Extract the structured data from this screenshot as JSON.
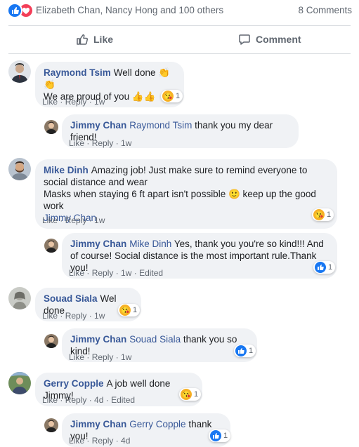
{
  "summary": {
    "reaction_names": "Elizabeth Chan, Nancy Hong and 100 others",
    "comment_count": "8 Comments"
  },
  "actions": {
    "like": "Like",
    "comment": "Comment"
  },
  "meta_words": {
    "like": "Like",
    "reply": "Reply",
    "sep": " · ",
    "edited": "Edited"
  },
  "colors": {
    "link": "#385898",
    "like_blue": "#1877f2",
    "love_red": "#f33e58",
    "bubble": "#f0f2f5"
  },
  "comments": [
    {
      "author": "Raymond Tsim",
      "line1": "Well done 👏👏",
      "line2": "We are proud of you 👍👍",
      "time": "1w",
      "reaction": {
        "icon": "care-emoji-icon",
        "count": "1"
      }
    },
    {
      "author": "Jimmy Chan",
      "mention": "Raymond Tsim",
      "text": "thank you my dear friend!",
      "time": "1w"
    },
    {
      "author": "Mike Dinh",
      "line1": "Amazing job! Just make sure to remind everyone to social distance and wear",
      "line2": "Masks when staying 6 ft apart isn't possible 🙂 keep up the good work",
      "mention": "Jimmy Chan",
      "time": "1w",
      "reaction": {
        "icon": "care-emoji-icon",
        "count": "1"
      }
    },
    {
      "author": "Jimmy Chan",
      "mention": "Mike Dinh",
      "text": "Yes, thank you you're so kind!!! And of course! Social distance is the most important rule.Thank you!",
      "time": "1w",
      "edited": true,
      "reaction": {
        "icon": "like-icon",
        "count": "1"
      }
    },
    {
      "author": "Souad Siala",
      "text": "Wel done",
      "time": "1w",
      "reaction": {
        "icon": "care-emoji-icon",
        "count": "1"
      }
    },
    {
      "author": "Jimmy Chan",
      "mention": "Souad Siala",
      "text": "thank you so kind!",
      "time": "1w",
      "reaction": {
        "icon": "like-icon",
        "count": "1"
      }
    },
    {
      "author": "Gerry Copple",
      "text": "A job well done Jimmy!",
      "time": "4d",
      "edited": true,
      "reaction": {
        "icon": "care-emoji-icon",
        "count": "1"
      }
    },
    {
      "author": "Jimmy Chan",
      "mention": "Gerry Copple",
      "text": "thank you!",
      "time": "4d",
      "reaction": {
        "icon": "like-icon",
        "count": "1"
      }
    }
  ]
}
